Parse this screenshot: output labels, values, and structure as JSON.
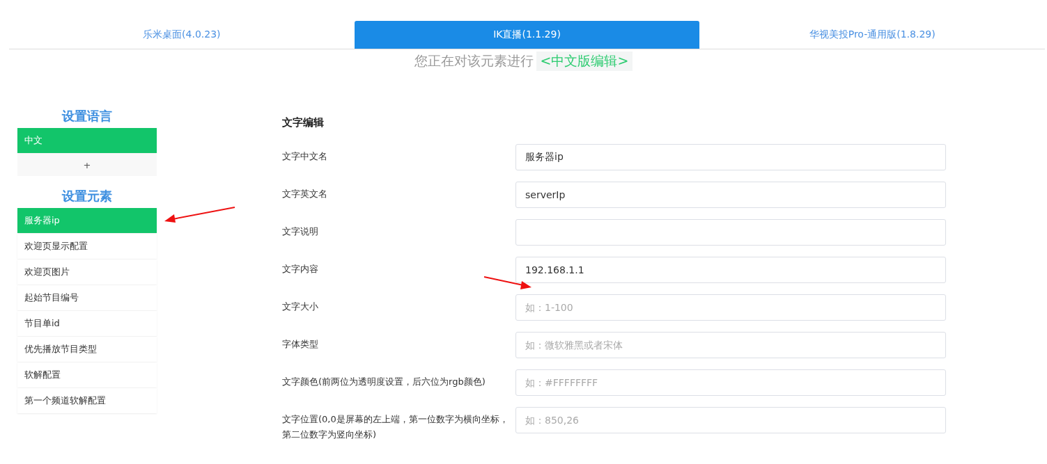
{
  "tabs": [
    {
      "label": "乐米桌面(4.0.23)",
      "selected": false
    },
    {
      "label": "IK直播(1.1.29)",
      "selected": true
    },
    {
      "label": "华视美投Pro-通用版(1.8.29)",
      "selected": false
    }
  ],
  "notice": {
    "text": "您正在对该元素进行",
    "tag": "<中文版编辑>"
  },
  "sidebar": {
    "language_heading": "设置语言",
    "languages": [
      {
        "label": "中文",
        "selected": true
      }
    ],
    "add_button": "+",
    "element_heading": "设置元素",
    "elements": [
      {
        "label": "服务器ip",
        "selected": true
      },
      {
        "label": "欢迎页显示配置",
        "selected": false
      },
      {
        "label": "欢迎页图片",
        "selected": false
      },
      {
        "label": "起始节目编号",
        "selected": false
      },
      {
        "label": "节目单id",
        "selected": false
      },
      {
        "label": "优先播放节目类型",
        "selected": false
      },
      {
        "label": "软解配置",
        "selected": false
      },
      {
        "label": "第一个频道软解配置",
        "selected": false
      }
    ]
  },
  "form": {
    "title": "文字编辑",
    "fields": [
      {
        "label": "文字中文名",
        "value": "服务器ip"
      },
      {
        "label": "文字英文名",
        "value": "serverIp"
      },
      {
        "label": "文字说明"
      },
      {
        "label": "文字内容",
        "value": "192.168.1.1"
      },
      {
        "label": "文字大小",
        "placeholder": "如：1-100"
      },
      {
        "label": "字体类型",
        "placeholder": "如：微软雅黑或者宋体"
      },
      {
        "label": "文字颜色(前两位为透明度设置，后六位为rgb颜色)",
        "placeholder": "如：#FFFFFFFF"
      },
      {
        "label": "文字位置(0,0是屏幕的左上端，第一位数字为横向坐标，第二位数字为竖向坐标)",
        "placeholder": "如：850,26"
      }
    ]
  }
}
